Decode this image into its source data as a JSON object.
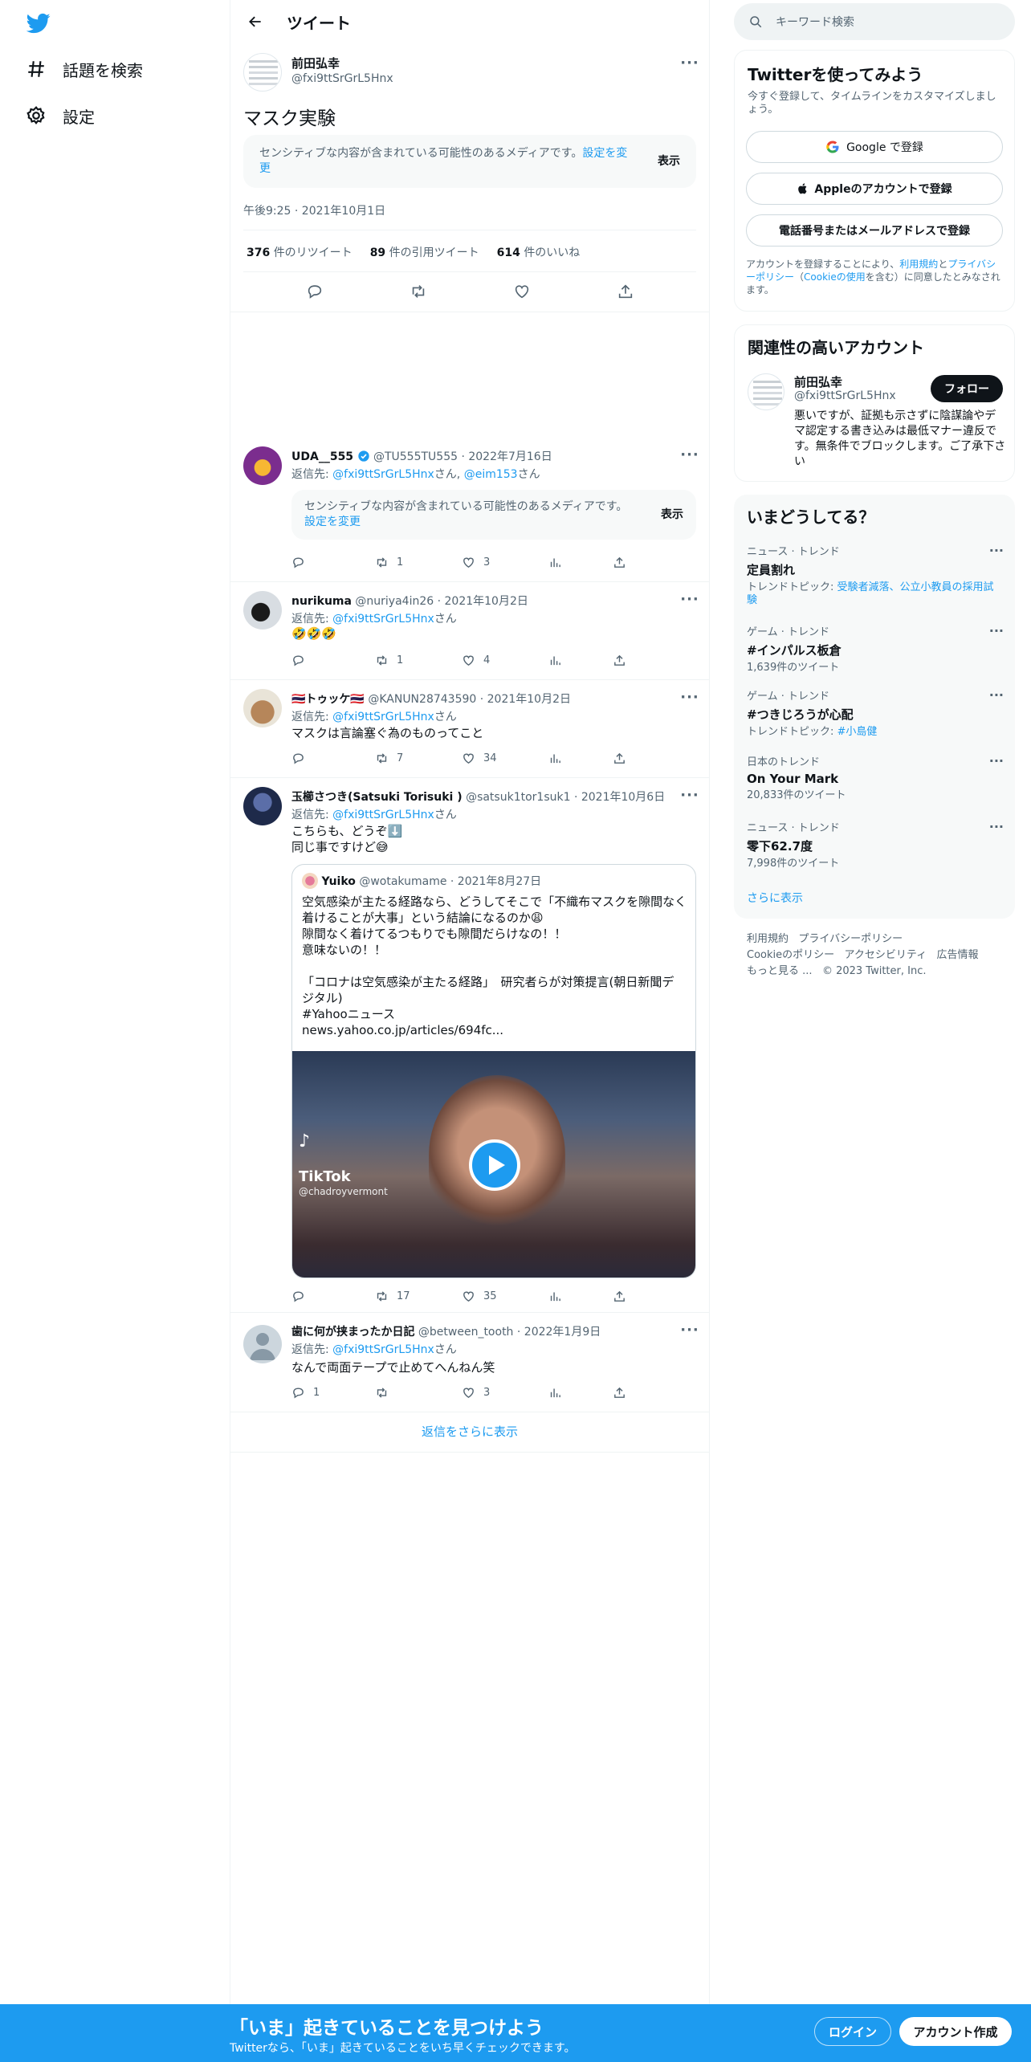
{
  "nav": {
    "explore": "話題を検索",
    "settings": "設定"
  },
  "header": {
    "title": "ツイート",
    "back_label": "←"
  },
  "main_tweet": {
    "name": "前田弘幸",
    "handle": "@fxi9ttSrGrL5Hnx",
    "text": "マスク実験",
    "sensitive_text": "センシティブな内容が含まれている可能性のあるメディアです。",
    "sensitive_link": "設定を変更",
    "sensitive_show": "表示",
    "timestamp": "午後9:25 · 2021年10月1日",
    "retweets_count": "376",
    "retweets_label": "件のリツイート",
    "quotes_count": "89",
    "quotes_label": "件の引用ツイート",
    "likes_count": "614",
    "likes_label": "件のいいね"
  },
  "replies": [
    {
      "name": "UDA__555",
      "handle": "@TU555TU555",
      "date": "· 2022年7月16日",
      "reply_prefix": "返信先: ",
      "reply_to": "@fxi9ttSrGrL5Hnx",
      "reply_mid": "さん, ",
      "reply_to2": "@eim153",
      "reply_suffix": "さん",
      "sensitive_text": "センシティブな内容が含まれている可能性のあるメディアです。",
      "sensitive_link": "設定を変更",
      "sensitive_show": "表示",
      "retweets": "1",
      "likes": "3"
    },
    {
      "name": "nurikuma",
      "handle": "@nuriya4in26",
      "date": "· 2021年10月2日",
      "reply_prefix": "返信先: ",
      "reply_to": "@fxi9ttSrGrL5Hnx",
      "reply_suffix": "さん",
      "text": "🤣🤣🤣",
      "retweets": "1",
      "likes": "4"
    },
    {
      "name": "🇹🇭トゥッケ🇹🇭",
      "handle": "@KANUN28743590",
      "date": "· 2021年10月2日",
      "reply_prefix": "返信先: ",
      "reply_to": "@fxi9ttSrGrL5Hnx",
      "reply_suffix": "さん",
      "text": "マスクは言論塞ぐ為のものってこと",
      "retweets": "7",
      "likes": "34"
    },
    {
      "name": "玉櫛さつき(Satsuki Torisuki )",
      "handle": "@satsuk1tor1suk1",
      "date": "· 2021年10月6日",
      "reply_prefix": "返信先: ",
      "reply_to": "@fxi9ttSrGrL5Hnx",
      "reply_suffix": "さん",
      "text1": "こちらも、どうぞ⬇️",
      "text2": "同じ事ですけど😅",
      "quote": {
        "name": "Yuiko",
        "handle": "@wotakumame",
        "date": "· 2021年8月27日",
        "l1": "空気感染が主たる経路なら、どうしてそこで「不織布マスクを隙間なく",
        "l2": "着けることが大事」という結論になるのか😩",
        "l3": "隙間なく着けてるつもりでも隙間だらけなの！！",
        "l4": "意味ないの！！",
        "l5": "「コロナは空気感染が主たる経路」　研究者らが対策提言(朝日新聞デ",
        "l6": "ジタル)",
        "l7": "#Yahooニュース",
        "l8": "news.yahoo.co.jp/articles/694fc...",
        "video_brand": "TikTok",
        "video_user": "@chadroyvermont"
      },
      "retweets": "17",
      "likes": "35"
    },
    {
      "name": "歯に何が挟まったか日記",
      "handle": "@between_tooth",
      "date": "· 2022年1月9日",
      "reply_prefix": "返信先: ",
      "reply_to": "@fxi9ttSrGrL5Hnx",
      "reply_suffix": "さん",
      "text": "なんで両面テープで止めてへんねん笑",
      "replies": "1",
      "likes": "3"
    }
  ],
  "show_more_replies": "返信をさらに表示",
  "right": {
    "search_placeholder": "キーワード検索",
    "signup": {
      "title": "Twitterを使ってみよう",
      "desc": "今すぐ登録して、タイムラインをカスタマイズしましょう。",
      "google": "Google で登録",
      "apple": "Appleのアカウントで登録",
      "phone": "電話番号またはメールアドレスで登録",
      "terms_pre": "アカウントを登録することにより、",
      "terms": "利用規約",
      "and": "と",
      "privacy": "プライバシーポリシー",
      "cookie_pre": "（",
      "cookie": "Cookieの使用",
      "terms_post": "を含む）に同意したとみなされます。"
    },
    "related": {
      "title": "関連性の高いアカウント",
      "name": "前田弘幸",
      "handle": "@fxi9ttSrGrL5Hnx",
      "follow": "フォロー",
      "bio": "悪いですが、証拠も示さずに陰謀論やデマ認定する書き込みは最低マナー違反です。無条件でブロックします。ご了承下さい"
    },
    "trends": {
      "title": "いまどうしてる？",
      "items": [
        {
          "cat": "ニュース · トレンド",
          "title": "定員割れ",
          "sub_pre": "トレンドトピック: ",
          "sub_link": "受験者減落、公立小教員の採用試験"
        },
        {
          "cat": "ゲーム · トレンド",
          "title": "#インパルス板倉",
          "sub": "1,639件のツイート"
        },
        {
          "cat": "ゲーム · トレンド",
          "title": "#つきじろうが心配",
          "sub_pre": "トレンドトピック: ",
          "sub_link": "#小島健"
        },
        {
          "cat": "日本のトレンド",
          "title": "On Your Mark",
          "sub": "20,833件のツイート"
        },
        {
          "cat": "ニュース · トレンド",
          "title": "零下62.7度",
          "sub": "7,998件のツイート"
        }
      ],
      "more": "さらに表示"
    },
    "footer": {
      "terms": "利用規約",
      "privacy": "プライバシーポリシー",
      "cookie": "Cookieのポリシー",
      "access": "アクセシビリティ",
      "ads": "広告情報",
      "more": "もっと見る ...",
      "copyright": "© 2023 Twitter, Inc."
    }
  },
  "bottom": {
    "headline": "「いま」起きていることを見つけよう",
    "sub": "Twitterなら、「いま」起きていることをいち早くチェックできます。",
    "login": "ログイン",
    "signup": "アカウント作成"
  }
}
